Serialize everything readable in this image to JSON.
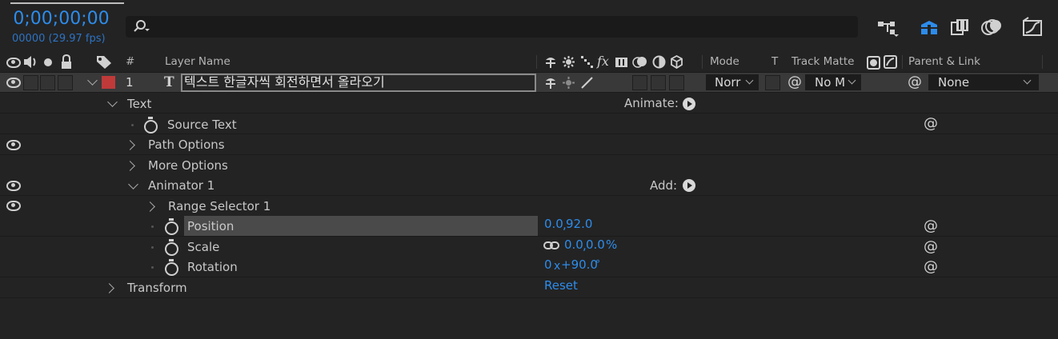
{
  "timecode": "0;00;00;00",
  "frame_info": "00000 (29.97 fps)",
  "search": {
    "icon": "search-icon"
  },
  "columns": {
    "number": "#",
    "layer_name": "Layer Name",
    "switches": "fx",
    "mode": "Mode",
    "t": "T",
    "track_matte": "Track Matte",
    "parent_link": "Parent & Link"
  },
  "layer": {
    "number": "1",
    "type_glyph": "T",
    "name": "텍스트 한글자씩 회전하면서 올라오기",
    "label_color": "#c03a3a",
    "mode": "Norr",
    "track_matte": "No M",
    "parent": "None"
  },
  "props": {
    "text": "Text",
    "animate_label": "Animate:",
    "source_text": "Source Text",
    "path_options": "Path Options",
    "more_options": "More Options",
    "animator": "Animator 1",
    "add_label": "Add:",
    "range_selector": "Range Selector 1",
    "position": "Position",
    "position_x": "0.0",
    "position_sep": ",",
    "position_y": "92.0",
    "scale": "Scale",
    "scale_x": "0.0",
    "scale_sep": ",",
    "scale_y": "0.0",
    "scale_unit": "%",
    "rotation": "Rotation",
    "rotation_rev": "0",
    "rotation_x": "x",
    "rotation_deg": "+90.0",
    "rotation_unit": "°",
    "transform": "Transform",
    "reset": "Reset"
  },
  "colors": {
    "accent": "#2d8ceb",
    "label_red": "#c03a3a",
    "bg": "#232323"
  }
}
